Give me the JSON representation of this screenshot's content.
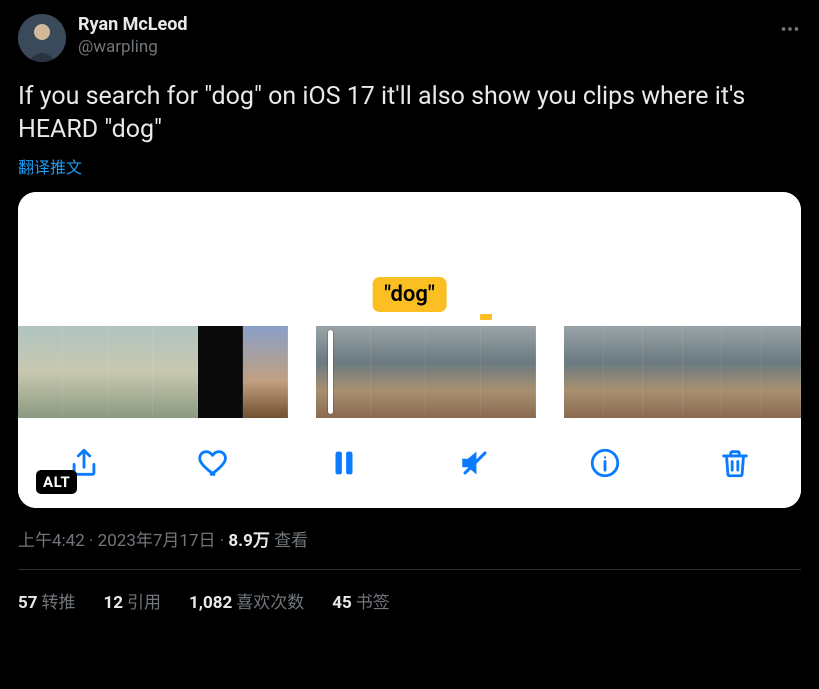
{
  "author": {
    "display_name": "Ryan McLeod",
    "handle": "@warpling"
  },
  "tweet_text": "If you search for \"dog\" on iOS 17 it'll also show you clips where it's HEARD \"dog\"",
  "translate_label": "翻译推文",
  "media": {
    "search_badge": "\"dog\"",
    "alt_badge": "ALT",
    "toolbar": {
      "share": "Share",
      "like": "Like",
      "pause": "Pause",
      "mute": "Mute",
      "info": "Info",
      "trash": "Delete"
    }
  },
  "meta": {
    "time": "上午4:42",
    "date": "2023年7月17日",
    "dot": " · ",
    "views_count": "8.9万",
    "views_label": " 查看"
  },
  "stats": {
    "retweets_count": "57",
    "retweets_label": "转推",
    "quotes_count": "12",
    "quotes_label": "引用",
    "likes_count": "1,082",
    "likes_label": "喜欢次数",
    "bookmarks_count": "45",
    "bookmarks_label": "书签"
  }
}
